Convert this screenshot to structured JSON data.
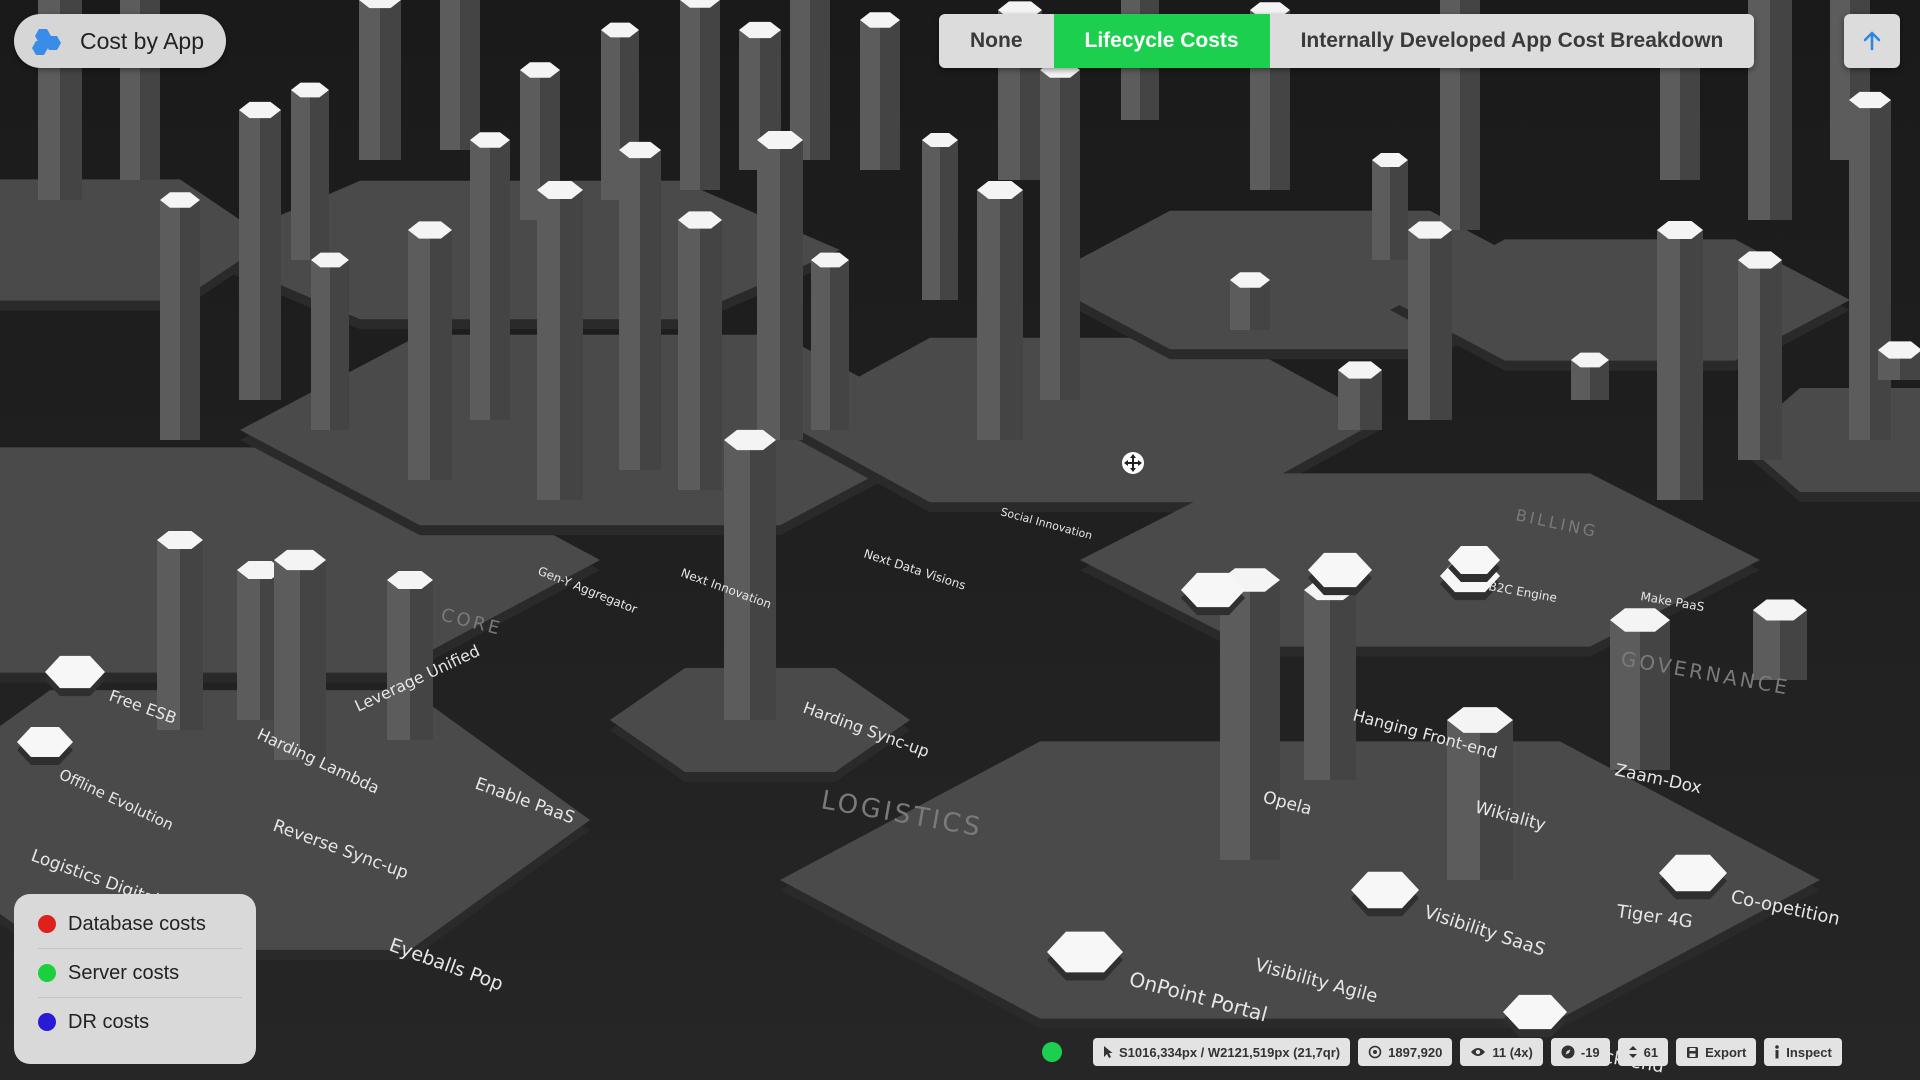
{
  "app": {
    "title": "Cost by App"
  },
  "view_switcher": {
    "options": [
      {
        "label": "None",
        "active": false
      },
      {
        "label": "Lifecycle Costs",
        "active": true
      },
      {
        "label": "Internally Developed App Cost Breakdown",
        "active": false
      }
    ],
    "up_icon": "arrow-up-icon"
  },
  "legend": {
    "items": [
      {
        "label": "Database costs",
        "color": "#e0201b"
      },
      {
        "label": "Server costs",
        "color": "#1ccf3c"
      },
      {
        "label": "DR costs",
        "color": "#2a1ad8"
      }
    ]
  },
  "scene": {
    "regions": [
      "CORE",
      "LOGISTICS",
      "BILLING",
      "GOVERNANCE"
    ],
    "apps": [
      "Free ESB",
      "Harding Lambda",
      "Leverage Unified",
      "Enable PaaS",
      "Offline Evolution",
      "Reverse Sync-up",
      "Logistics Digital",
      "Eyeballs Pop",
      "Harding Sync-up",
      "Next Innovation",
      "Gen-Y Aggregator",
      "Next Data Visions",
      "Social Innovation",
      "Opela",
      "Hanging Front-end",
      "Wikiality",
      "Zaam-Dox",
      "Co-opetition",
      "Tiger 4G",
      "Visibility SaaS",
      "Visibility Agile",
      "OnPoint Portal",
      "Make PaaS",
      "B2C Engine",
      "Back-end"
    ]
  },
  "status": {
    "indicator_color": "#1ccf4e",
    "cursor": "S1016,334px / W2121,519px (21,7qr)",
    "target": "1897,920",
    "visible": "11 (4x)",
    "rotation": "-19",
    "height": "61",
    "export_label": "Export",
    "inspect_label": "Inspect"
  }
}
